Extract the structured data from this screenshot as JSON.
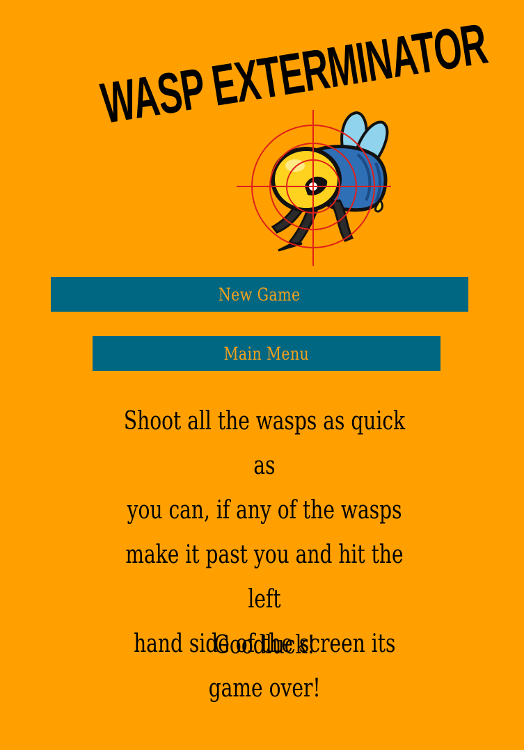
{
  "title": "WASP EXTERMINATOR",
  "logo": {
    "icon": "wasp-target-icon",
    "colors": {
      "crosshair": "#e0201a",
      "head": "#ffd21f",
      "body": "#2f6fb6",
      "wing": "#8fd3ec",
      "outline": "#111111"
    }
  },
  "buttons": {
    "new_game": "New Game",
    "main_menu": "Main Menu"
  },
  "instructions": {
    "lines": [
      "Shoot all the wasps as quick as",
      "you can, if any of the wasps",
      "make it past you and hit the left",
      "hand side of the screen its",
      "game over!"
    ],
    "sign_off": "Goodluck!"
  },
  "colors": {
    "background": "#ffa000",
    "button_bg": "#006783",
    "button_text": "#f7a21a",
    "text": "#000000"
  }
}
